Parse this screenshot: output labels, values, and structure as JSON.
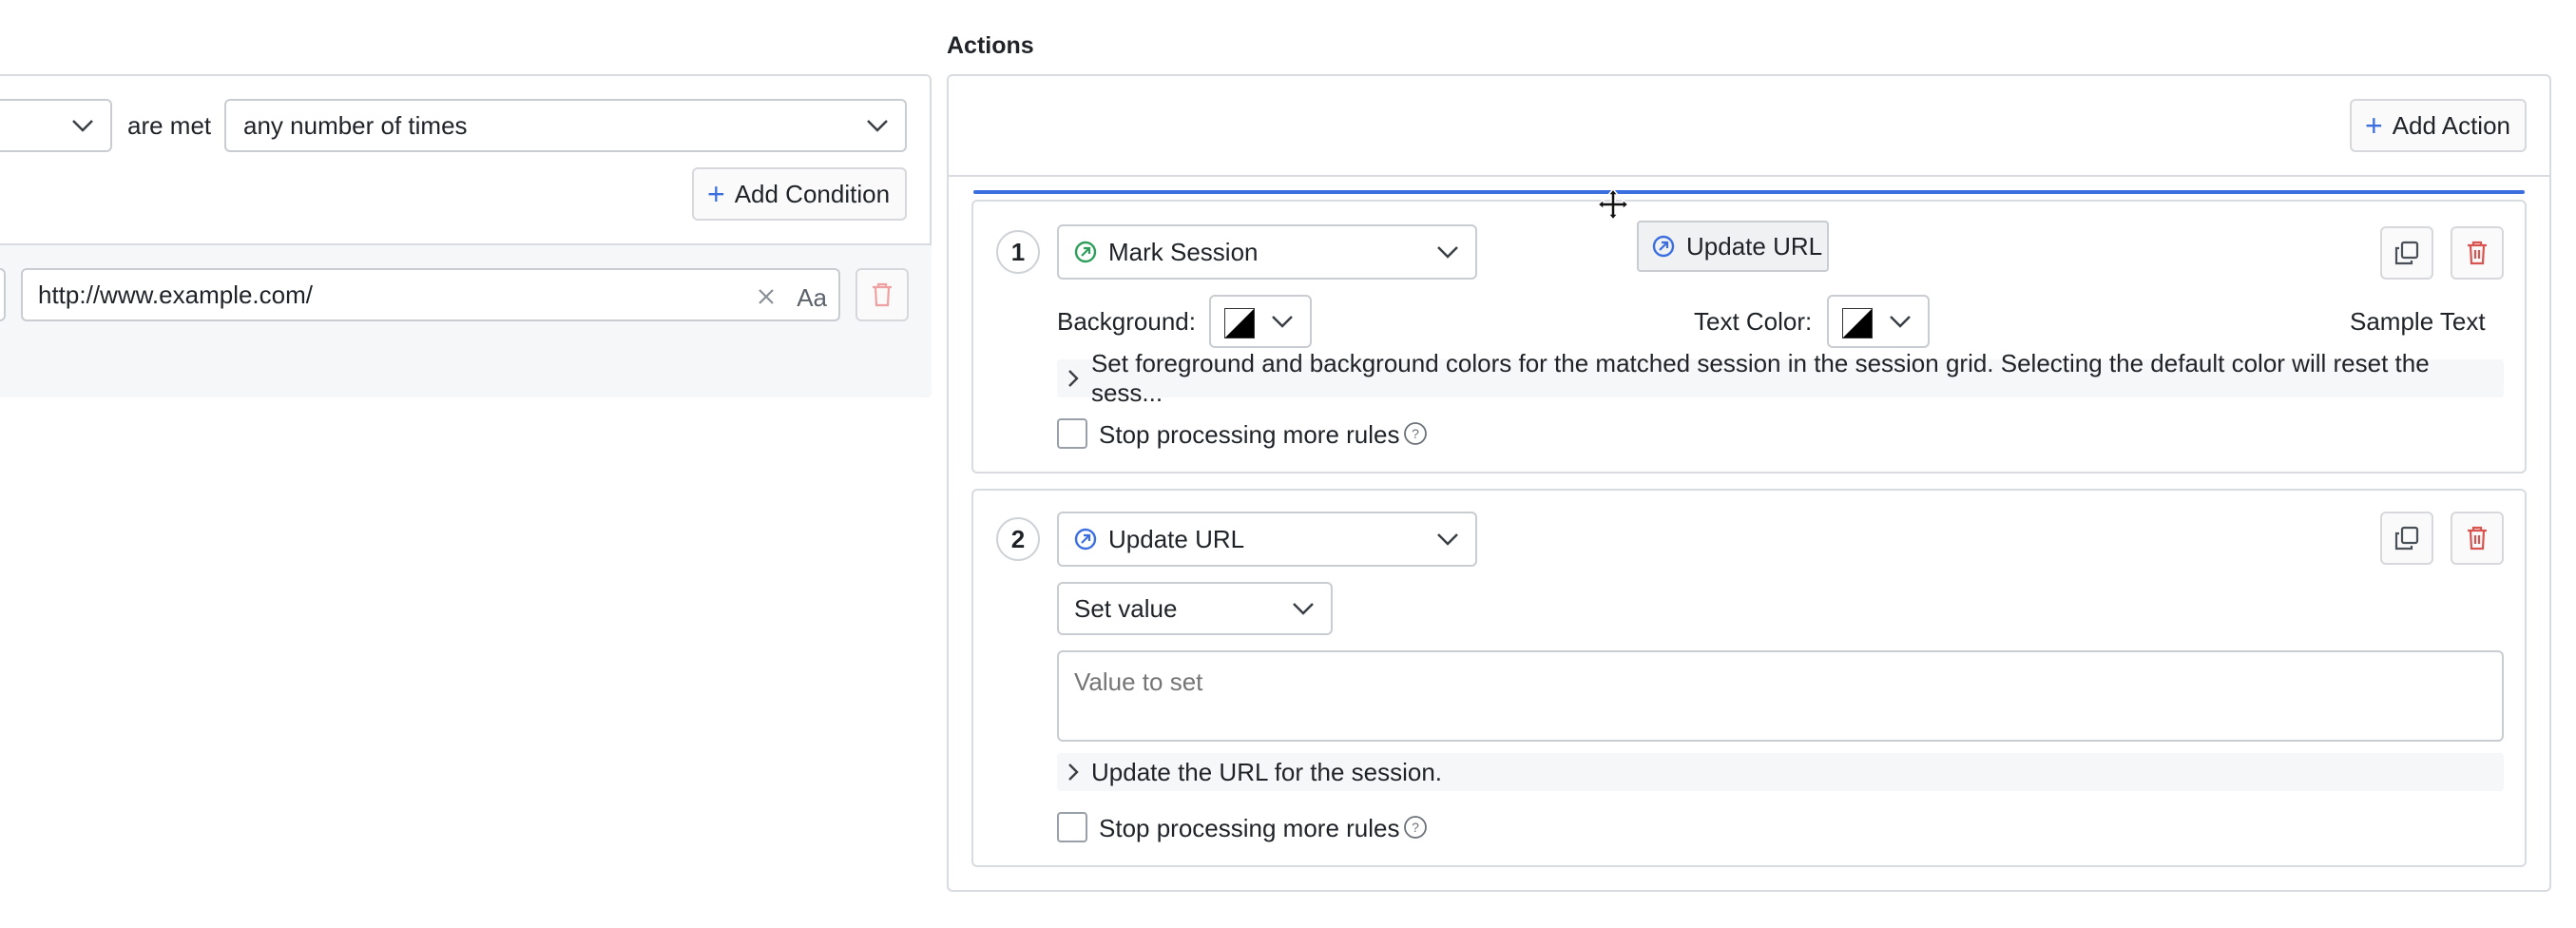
{
  "conditions": {
    "are_met_label": "are met",
    "frequency_value": "any number of times",
    "add_condition_label": "Add Condition",
    "url_value": "http://www.example.com/",
    "match_case_label": "Aa"
  },
  "actions": {
    "section_title": "Actions",
    "add_action_label": "Add Action",
    "drag_tooltip_label": "Update URL",
    "items": [
      {
        "number": "1",
        "type": "Mark Session",
        "background_label": "Background:",
        "text_color_label": "Text Color:",
        "sample_text": "Sample Text",
        "description": "Set foreground and background colors for the matched session in the session grid. Selecting the default color will reset the sess...",
        "stop_label": "Stop processing more rules"
      },
      {
        "number": "2",
        "type": "Update URL",
        "mode_value": "Set value",
        "value_placeholder": "Value to set",
        "description": "Update the URL for the session.",
        "stop_label": "Stop processing more rules"
      }
    ]
  },
  "colors": {
    "accent": "#3b6fe0",
    "delete": "#d9534f",
    "mark_session_icon": "#2e9e5b",
    "border": "#d8dbe0"
  }
}
